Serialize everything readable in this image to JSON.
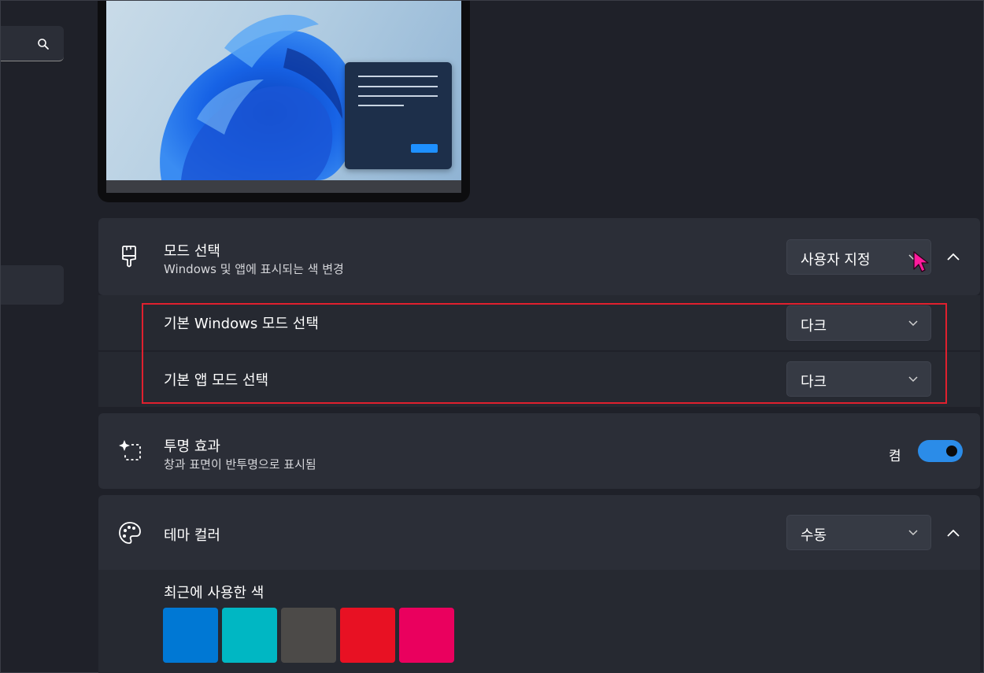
{
  "mode_select": {
    "title": "모드 선택",
    "subtitle": "Windows 및 앱에 표시되는 색 변경",
    "dropdown_value": "사용자 지정",
    "icon": "paintbrush-icon"
  },
  "windows_mode": {
    "title": "기본 Windows 모드 선택",
    "dropdown_value": "다크"
  },
  "app_mode": {
    "title": "기본 앱 모드 선택",
    "dropdown_value": "다크"
  },
  "transparency": {
    "title": "투명 효과",
    "subtitle": "창과 표면이 반투명으로 표시됨",
    "toggle_label": "켬",
    "toggle_on": true,
    "icon": "sparkle-select-icon"
  },
  "theme_color": {
    "title": "테마 컬러",
    "dropdown_value": "수동",
    "icon": "palette-icon"
  },
  "recent_colors": {
    "title": "최근에 사용한 색",
    "colors": [
      "#0078d4",
      "#00b7c3",
      "#4c4a48",
      "#e81123",
      "#ea005e"
    ]
  },
  "colors": {
    "accent": "#2b8ce8",
    "highlight_box": "#e0202e",
    "cursor": "#ff1a9c"
  }
}
